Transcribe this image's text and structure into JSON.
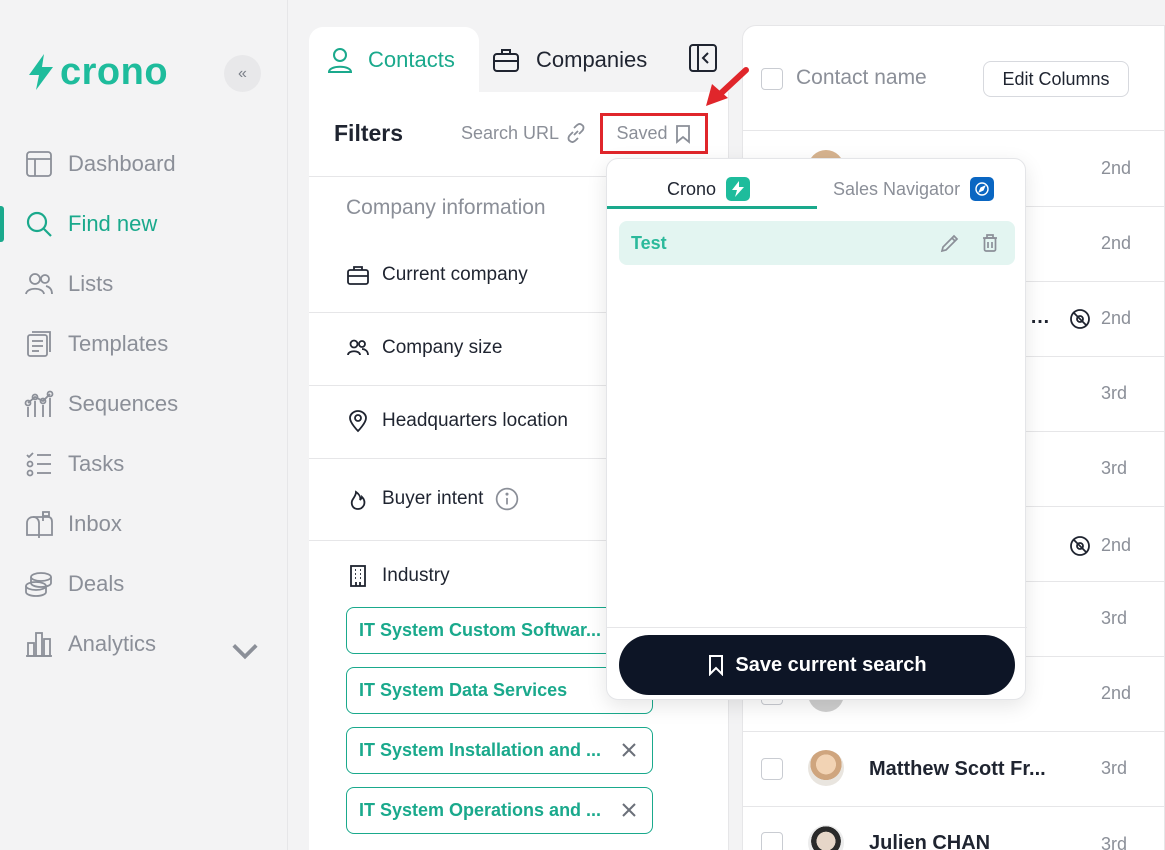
{
  "brand": {
    "name": "crono",
    "accent": "#1ebc9c"
  },
  "sidebar": {
    "collapse_glyph": "«",
    "items": [
      {
        "label": "Dashboard",
        "icon": "dashboard-icon"
      },
      {
        "label": "Find new",
        "icon": "search-icon",
        "active": true
      },
      {
        "label": "Lists",
        "icon": "users-icon"
      },
      {
        "label": "Templates",
        "icon": "templates-icon"
      },
      {
        "label": "Sequences",
        "icon": "sequences-icon"
      },
      {
        "label": "Tasks",
        "icon": "tasks-icon"
      },
      {
        "label": "Inbox",
        "icon": "inbox-icon"
      },
      {
        "label": "Deals",
        "icon": "deals-icon"
      },
      {
        "label": "Analytics",
        "icon": "analytics-icon"
      }
    ]
  },
  "tabs": {
    "contacts": "Contacts",
    "companies": "Companies"
  },
  "filters": {
    "title": "Filters",
    "search_url": "Search URL",
    "saved": "Saved",
    "section_title": "Company information",
    "rows": {
      "current_company": "Current company",
      "company_size": "Company size",
      "hq_location": "Headquarters location",
      "buyer_intent": "Buyer intent",
      "industry": "Industry"
    },
    "chips": [
      "IT System Custom Softwar...",
      "IT System Data Services",
      "IT System Installation and ...",
      "IT System Operations and ..."
    ]
  },
  "table": {
    "header": {
      "contact_name": "Contact name",
      "edit_columns": "Edit Columns"
    },
    "rows": [
      {
        "name": "",
        "degree": "2nd"
      },
      {
        "name": "",
        "degree": "2nd"
      },
      {
        "name": "",
        "degree": "2nd",
        "partial": "…"
      },
      {
        "name": "",
        "degree": "3rd"
      },
      {
        "name": "",
        "degree": "3rd"
      },
      {
        "name": "",
        "degree": "2nd"
      },
      {
        "name": "",
        "degree": "3rd"
      },
      {
        "name": "",
        "degree": "2nd"
      },
      {
        "name": "Matthew Scott Fr...",
        "degree": "3rd"
      },
      {
        "name": "Julien CHAN",
        "degree": "3rd"
      }
    ]
  },
  "saved_dropdown": {
    "tab_crono": "Crono",
    "tab_sales_navigator": "Sales Navigator",
    "items": [
      {
        "label": "Test"
      }
    ],
    "save_button": "Save current search"
  }
}
